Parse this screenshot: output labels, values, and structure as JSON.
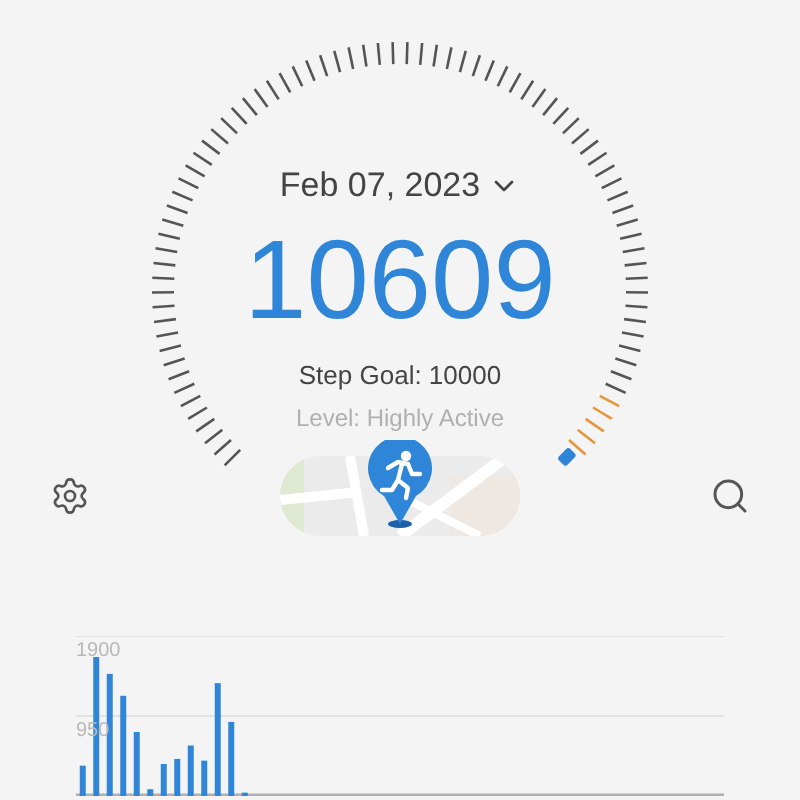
{
  "header": {
    "date": "Feb 07, 2023",
    "steps": "10609",
    "goal": "Step Goal: 10000",
    "activity_level": "Level: Highly Active"
  },
  "chart": {
    "chart_data": {
      "type": "bar",
      "ylim": [
        0,
        1900
      ],
      "yticks": [
        {
          "value": 950,
          "label": "950"
        },
        {
          "value": 1900,
          "label": "1900"
        }
      ],
      "series": [
        {
          "color": "#2f86d8",
          "values": [
            360,
            1650,
            1450,
            1190,
            760,
            80,
            380,
            440,
            600,
            420,
            1340,
            880,
            40,
            null,
            null,
            null,
            null,
            null,
            null,
            null,
            null,
            null,
            null,
            null,
            null,
            null,
            null,
            null,
            null,
            null,
            null,
            null,
            null,
            null,
            null,
            null,
            null,
            null,
            null,
            null,
            null,
            null,
            null,
            null,
            null,
            null,
            null,
            null
          ]
        }
      ]
    }
  }
}
